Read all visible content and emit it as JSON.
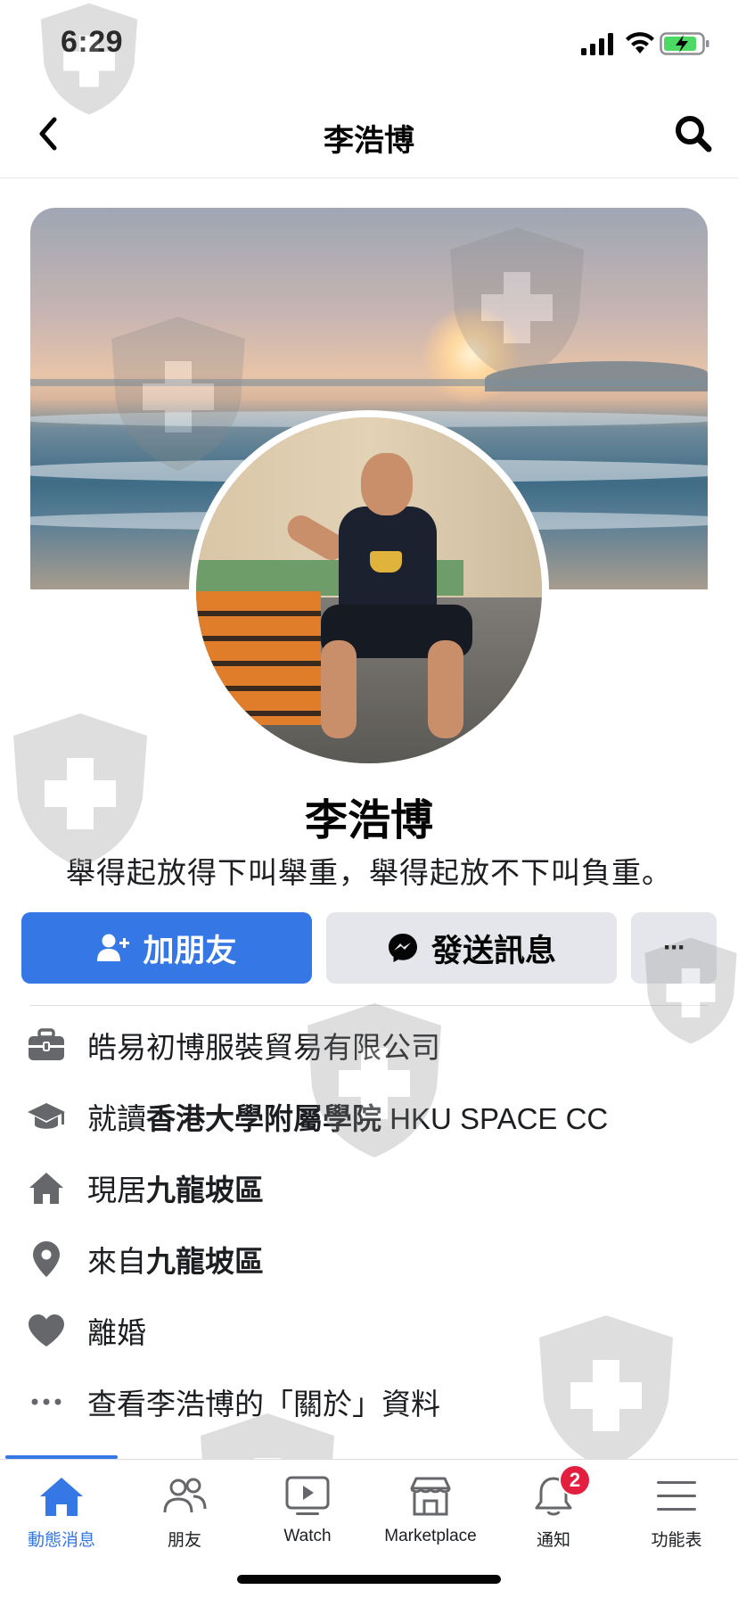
{
  "status_bar": {
    "time": "6:29"
  },
  "nav": {
    "title": "李浩博"
  },
  "profile": {
    "name": "李浩博",
    "bio": "舉得起放得下叫舉重，舉得起放不下叫負重。"
  },
  "actions": {
    "add_friend_label": "加朋友",
    "message_label": "發送訊息",
    "more_label": "···"
  },
  "info": {
    "work": "皓易初博服裝貿易有限公司",
    "education_prefix": "就讀",
    "education_school": "香港大學附屬學院",
    "education_suffix": " HKU SPACE CC",
    "lives_prefix": "現居",
    "lives_place": "九龍坡區",
    "from_prefix": "來自",
    "from_place": "九龍坡區",
    "relationship": "離婚",
    "see_about": "查看李浩博的「關於」資料"
  },
  "tabs": [
    {
      "label": "動態消息",
      "icon": "home-icon",
      "active": true
    },
    {
      "label": "朋友",
      "icon": "friends-icon"
    },
    {
      "label": "Watch",
      "icon": "watch-icon"
    },
    {
      "label": "Marketplace",
      "icon": "marketplace-icon"
    },
    {
      "label": "通知",
      "icon": "bell-icon",
      "badge": "2"
    },
    {
      "label": "功能表",
      "icon": "menu-icon"
    }
  ],
  "colors": {
    "accent": "#3578e5",
    "button_gray": "#e4e6eb",
    "badge": "#e41e3f"
  }
}
